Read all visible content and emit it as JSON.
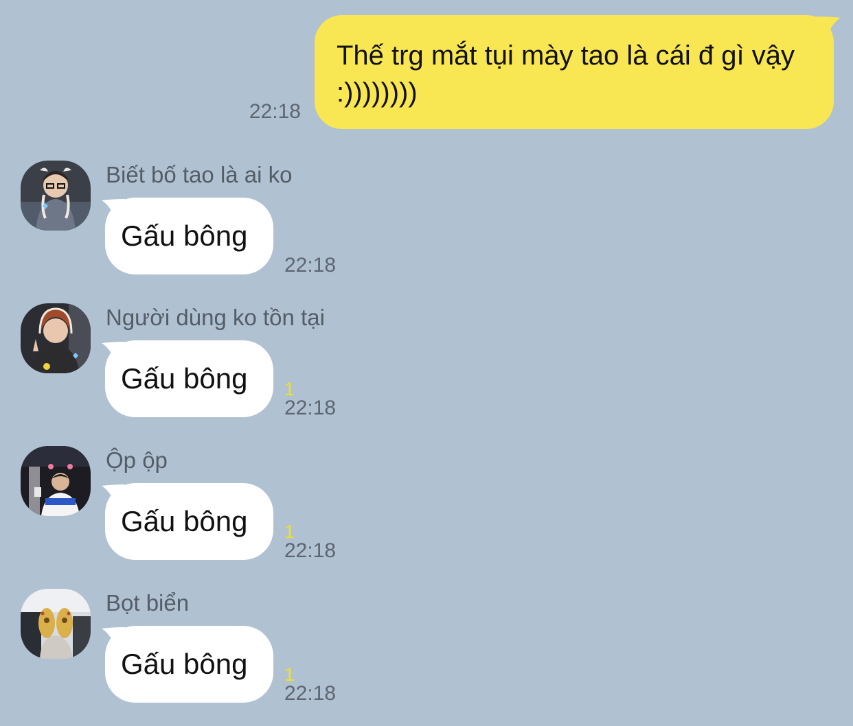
{
  "colors": {
    "background": "#b0c1d1",
    "outgoing_bubble": "#f8e652",
    "incoming_bubble": "#ffffff",
    "unread_count": "#f2e21e",
    "meta_text": "#5d6670"
  },
  "outgoing": {
    "text": "Thế trg mắt tụi mày tao là cái đ gì vậy :))))))))",
    "time": "22:18"
  },
  "incoming": [
    {
      "sender": "Biết bố tao là ai ko",
      "text": "Gấu bông",
      "unread": "",
      "time": "22:18",
      "avatar": "avatar-photo"
    },
    {
      "sender": "Người dùng ko tồn tại",
      "text": "Gấu bông",
      "unread": "1",
      "time": "22:18",
      "avatar": "avatar-photo"
    },
    {
      "sender": "Ộp ộp",
      "text": "Gấu bông",
      "unread": "1",
      "time": "22:18",
      "avatar": "avatar-photo"
    },
    {
      "sender": "Bọt biển",
      "text": "Gấu bông",
      "unread": "1",
      "time": "22:18",
      "avatar": "avatar-photo"
    }
  ]
}
